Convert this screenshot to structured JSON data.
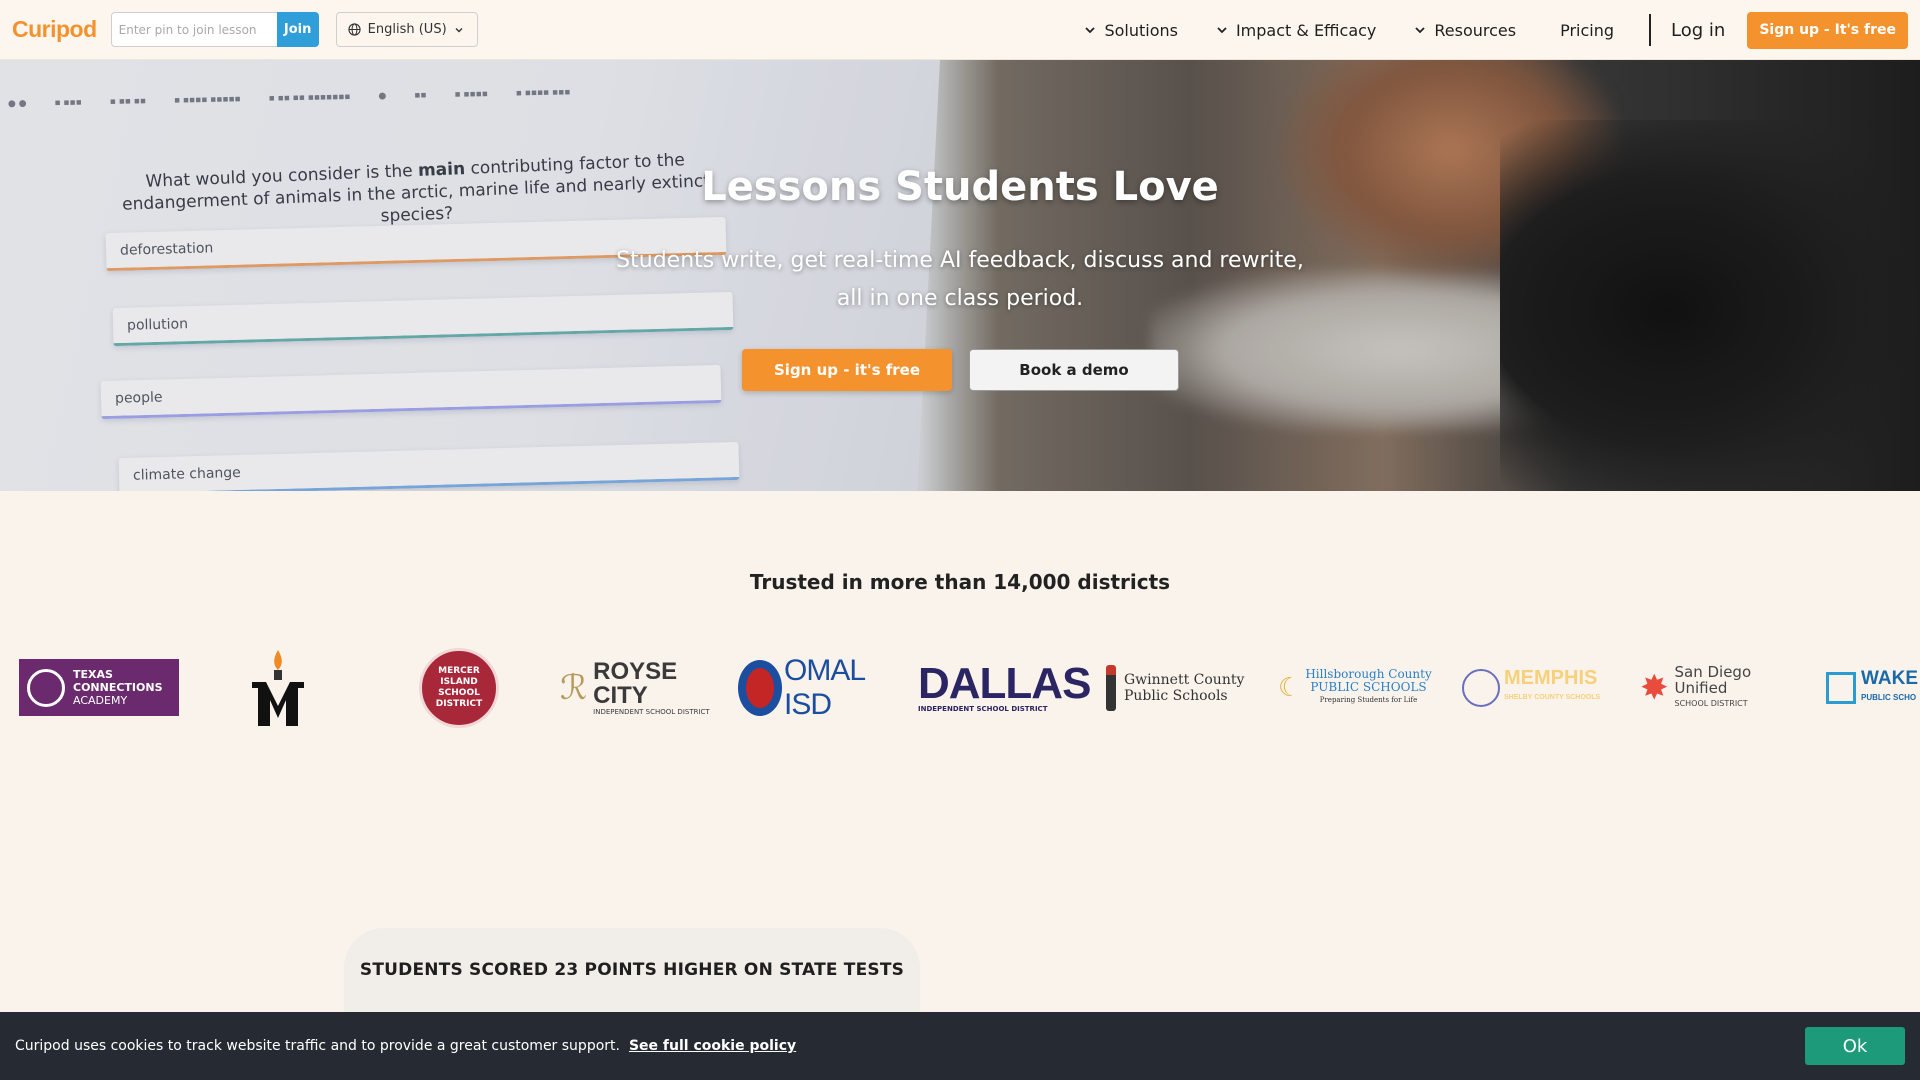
{
  "nav": {
    "logo": "Curipod",
    "pin_placeholder": "Enter pin to join lesson",
    "join_label": "Join",
    "language": "English (US)",
    "links": {
      "solutions": "Solutions",
      "impact": "Impact & Efficacy",
      "resources": "Resources",
      "pricing": "Pricing"
    },
    "login": "Log in",
    "signup": "Sign up - It's free"
  },
  "hero": {
    "title": "Lessons Students Love",
    "subtitle_line1": "Students write, get real-time AI feedback, discuss and rewrite,",
    "subtitle_line2": "all in one class period.",
    "signup_button": "Sign up - it's free",
    "demo_button": "Book a demo",
    "background_quiz": {
      "question_pre": "What would you consider is the ",
      "question_bold": "main",
      "question_post": " contributing factor to the endangerment of animals in the arctic, marine life and nearly extinct species?",
      "options": [
        "deforestation",
        "pollution",
        "people",
        "climate change"
      ]
    }
  },
  "trusted": {
    "heading": "Trusted in more than 14,000 districts",
    "logos": {
      "texas": {
        "line1": "TEXAS",
        "line2": "CONNECTIONS",
        "line3": "ACADEMY"
      },
      "mercer": "MERCER ISLAND SCHOOL DISTRICT",
      "royse": {
        "name": "ROYSE CITY",
        "sub": "INDEPENDENT SCHOOL DISTRICT"
      },
      "comal": "OMAL ISD",
      "dallas": {
        "name": "DALLAS",
        "sub": "INDEPENDENT SCHOOL DISTRICT"
      },
      "gwinnett": {
        "line1": "Gwinnett County",
        "line2": "Public Schools"
      },
      "hillsborough": {
        "line1": "Hillsborough County",
        "line2": "PUBLIC SCHOOLS",
        "line3": "Preparing Students for Life"
      },
      "memphis": {
        "name": "MEMPHIS",
        "sub": "SHELBY COUNTY SCHOOLS"
      },
      "sandiego": {
        "name": "San Diego Unified",
        "sub": "SCHOOL DISTRICT"
      },
      "wake": {
        "name": "WAKE C",
        "sub": "PUBLIC SCHO"
      }
    }
  },
  "stats": {
    "title": "STUDENTS SCORED 23 POINTS HIGHER ON STATE TESTS"
  },
  "cookie": {
    "text": "Curipod uses cookies to track website traffic and to provide a great customer support.",
    "link": "See full cookie policy",
    "ok": "Ok"
  },
  "colors": {
    "brand_orange": "#f4922e",
    "join_blue": "#2f9ed9",
    "cookie_bg": "#262b33",
    "ok_green": "#1d9a7a",
    "page_bg": "#faf3ec"
  }
}
